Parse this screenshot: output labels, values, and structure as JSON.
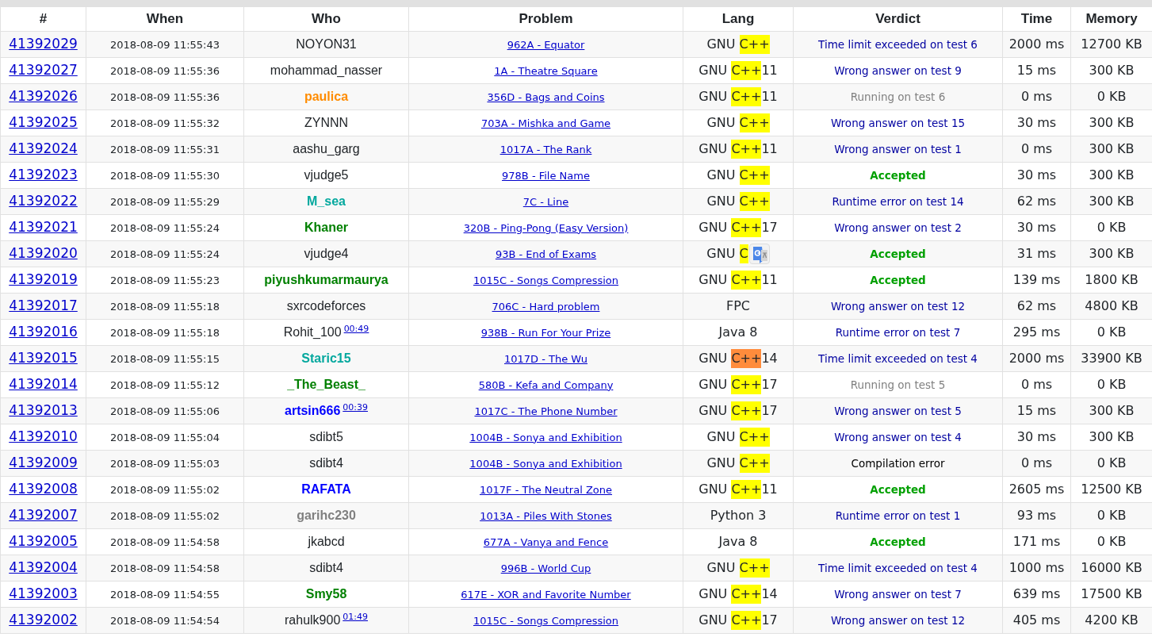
{
  "columns": [
    "#",
    "When",
    "Who",
    "Problem",
    "Lang",
    "Verdict",
    "Time",
    "Memory"
  ],
  "rows": [
    {
      "id": "41392029",
      "when": "2018-08-09 11:55:43",
      "who": {
        "name": "NOYON31"
      },
      "problem": "962A - Equator",
      "lang": {
        "prefix": "GNU ",
        "highlight": "C++",
        "color": "#ffff00"
      },
      "verdict": {
        "text": "Time limit exceeded on test 6",
        "kind": "rejected"
      },
      "time": "2000 ms",
      "memory": "12700 KB"
    },
    {
      "id": "41392027",
      "when": "2018-08-09 11:55:36",
      "who": {
        "name": "mohammad_nasser"
      },
      "problem": "1A - Theatre Square",
      "lang": {
        "prefix": "GNU ",
        "highlight": "C++",
        "suffix": "11",
        "color": "#ffff00"
      },
      "verdict": {
        "text": "Wrong answer on test 9",
        "kind": "rejected"
      },
      "time": "15 ms",
      "memory": "300 KB"
    },
    {
      "id": "41392026",
      "when": "2018-08-09 11:55:36",
      "who": {
        "name": "paulica",
        "color": "#ff8c00"
      },
      "problem": "356D - Bags and Coins",
      "lang": {
        "prefix": "GNU ",
        "highlight": "C++",
        "suffix": "11",
        "color": "#ffff00"
      },
      "verdict": {
        "text": "Running on test 6",
        "kind": "running"
      },
      "time": "0 ms",
      "memory": "0 KB"
    },
    {
      "id": "41392025",
      "when": "2018-08-09 11:55:32",
      "who": {
        "name": "ZYNNN"
      },
      "problem": "703A - Mishka and Game",
      "lang": {
        "prefix": "GNU ",
        "highlight": "C++",
        "color": "#ffff00"
      },
      "verdict": {
        "text": "Wrong answer on test 15",
        "kind": "rejected"
      },
      "time": "30 ms",
      "memory": "300 KB"
    },
    {
      "id": "41392024",
      "when": "2018-08-09 11:55:31",
      "who": {
        "name": "aashu_garg"
      },
      "problem": "1017A - The Rank",
      "lang": {
        "prefix": "GNU ",
        "highlight": "C++",
        "suffix": "11",
        "color": "#ffff00"
      },
      "verdict": {
        "text": "Wrong answer on test 1",
        "kind": "rejected"
      },
      "time": "0 ms",
      "memory": "300 KB"
    },
    {
      "id": "41392023",
      "when": "2018-08-09 11:55:30",
      "who": {
        "name": "vjudge5"
      },
      "problem": "978B - File Name",
      "lang": {
        "prefix": "GNU ",
        "highlight": "C++",
        "color": "#ffff00"
      },
      "verdict": {
        "text": "Accepted",
        "kind": "accepted"
      },
      "time": "30 ms",
      "memory": "300 KB"
    },
    {
      "id": "41392022",
      "when": "2018-08-09 11:55:29",
      "who": {
        "name": "M_sea",
        "color": "#03a89e"
      },
      "problem": "7C - Line",
      "lang": {
        "prefix": "GNU ",
        "highlight": "C++",
        "color": "#ffff00"
      },
      "verdict": {
        "text": "Runtime error on test 14",
        "kind": "rejected"
      },
      "time": "62 ms",
      "memory": "300 KB"
    },
    {
      "id": "41392021",
      "when": "2018-08-09 11:55:24",
      "who": {
        "name": "Khaner",
        "color": "#008000"
      },
      "problem": "320B - Ping-Pong (Easy Version)",
      "lang": {
        "prefix": "GNU ",
        "highlight": "C++",
        "suffix": "17",
        "color": "#ffff00"
      },
      "verdict": {
        "text": "Wrong answer on test 2",
        "kind": "rejected"
      },
      "time": "30 ms",
      "memory": "0 KB"
    },
    {
      "id": "41392020",
      "when": "2018-08-09 11:55:24",
      "who": {
        "name": "vjudge4"
      },
      "problem": "93B - End of Exams",
      "lang": {
        "prefix": "GNU ",
        "highlight": "C",
        "color": "#ffff00",
        "translate_popup": true
      },
      "verdict": {
        "text": "Accepted",
        "kind": "accepted"
      },
      "time": "31 ms",
      "memory": "300 KB"
    },
    {
      "id": "41392019",
      "when": "2018-08-09 11:55:23",
      "who": {
        "name": "piyushkumarmaurya",
        "color": "#008000"
      },
      "problem": "1015C - Songs Compression",
      "lang": {
        "prefix": "GNU ",
        "highlight": "C++",
        "suffix": "11",
        "color": "#ffff00"
      },
      "verdict": {
        "text": "Accepted",
        "kind": "accepted"
      },
      "time": "139 ms",
      "memory": "1800 KB"
    },
    {
      "id": "41392017",
      "when": "2018-08-09 11:55:18",
      "who": {
        "name": "sxrcodeforces"
      },
      "problem": "706C - Hard problem",
      "lang": {
        "prefix": "FPC"
      },
      "verdict": {
        "text": "Wrong answer on test 12",
        "kind": "rejected"
      },
      "time": "62 ms",
      "memory": "4800 KB"
    },
    {
      "id": "41392016",
      "when": "2018-08-09 11:55:18",
      "who": {
        "name": "Rohit_100",
        "virtual": "00:49"
      },
      "problem": "938B - Run For Your Prize",
      "lang": {
        "prefix": "Java 8"
      },
      "verdict": {
        "text": "Runtime error on test 7",
        "kind": "rejected"
      },
      "time": "295 ms",
      "memory": "0 KB"
    },
    {
      "id": "41392015",
      "when": "2018-08-09 11:55:15",
      "who": {
        "name": "Staric15",
        "color": "#03a89e"
      },
      "problem": "1017D - The Wu",
      "lang": {
        "prefix": "GNU ",
        "highlight": "C++",
        "suffix": "14",
        "color": "#ff8c3c"
      },
      "verdict": {
        "text": "Time limit exceeded on test 4",
        "kind": "rejected"
      },
      "time": "2000 ms",
      "memory": "33900 KB"
    },
    {
      "id": "41392014",
      "when": "2018-08-09 11:55:12",
      "who": {
        "name": "_The_Beast_",
        "color": "#008000"
      },
      "problem": "580B - Kefa and Company",
      "lang": {
        "prefix": "GNU ",
        "highlight": "C++",
        "suffix": "17",
        "color": "#ffff00"
      },
      "verdict": {
        "text": "Running on test 5",
        "kind": "running"
      },
      "time": "0 ms",
      "memory": "0 KB"
    },
    {
      "id": "41392013",
      "when": "2018-08-09 11:55:06",
      "who": {
        "name": "artsin666",
        "color": "#0000ff",
        "virtual": "00:39"
      },
      "problem": "1017C - The Phone Number",
      "lang": {
        "prefix": "GNU ",
        "highlight": "C++",
        "suffix": "17",
        "color": "#ffff00"
      },
      "verdict": {
        "text": "Wrong answer on test 5",
        "kind": "rejected"
      },
      "time": "15 ms",
      "memory": "300 KB"
    },
    {
      "id": "41392010",
      "when": "2018-08-09 11:55:04",
      "who": {
        "name": "sdibt5"
      },
      "problem": "1004B - Sonya and Exhibition",
      "lang": {
        "prefix": "GNU ",
        "highlight": "C++",
        "color": "#ffff00"
      },
      "verdict": {
        "text": "Wrong answer on test 4",
        "kind": "rejected"
      },
      "time": "30 ms",
      "memory": "300 KB"
    },
    {
      "id": "41392009",
      "when": "2018-08-09 11:55:03",
      "who": {
        "name": "sdibt4"
      },
      "problem": "1004B - Sonya and Exhibition",
      "lang": {
        "prefix": "GNU ",
        "highlight": "C++",
        "color": "#ffff00"
      },
      "verdict": {
        "text": "Compilation error",
        "kind": "compile"
      },
      "time": "0 ms",
      "memory": "0 KB"
    },
    {
      "id": "41392008",
      "when": "2018-08-09 11:55:02",
      "who": {
        "name": "RAFATA",
        "color": "#0000ff"
      },
      "problem": "1017F - The Neutral Zone",
      "lang": {
        "prefix": "GNU ",
        "highlight": "C++",
        "suffix": "11",
        "color": "#ffff00"
      },
      "verdict": {
        "text": "Accepted",
        "kind": "accepted"
      },
      "time": "2605 ms",
      "memory": "12500 KB"
    },
    {
      "id": "41392007",
      "when": "2018-08-09 11:55:02",
      "who": {
        "name": "garihc230",
        "color": "#808080"
      },
      "problem": "1013A - Piles With Stones",
      "lang": {
        "prefix": "Python 3"
      },
      "verdict": {
        "text": "Runtime error on test 1",
        "kind": "rejected"
      },
      "time": "93 ms",
      "memory": "0 KB"
    },
    {
      "id": "41392005",
      "when": "2018-08-09 11:54:58",
      "who": {
        "name": "jkabcd"
      },
      "problem": "677A - Vanya and Fence",
      "lang": {
        "prefix": "Java 8"
      },
      "verdict": {
        "text": "Accepted",
        "kind": "accepted"
      },
      "time": "171 ms",
      "memory": "0 KB"
    },
    {
      "id": "41392004",
      "when": "2018-08-09 11:54:58",
      "who": {
        "name": "sdibt4"
      },
      "problem": "996B - World Cup",
      "lang": {
        "prefix": "GNU ",
        "highlight": "C++",
        "color": "#ffff00"
      },
      "verdict": {
        "text": "Time limit exceeded on test 4",
        "kind": "rejected"
      },
      "time": "1000 ms",
      "memory": "16000 KB"
    },
    {
      "id": "41392003",
      "when": "2018-08-09 11:54:55",
      "who": {
        "name": "Smy58",
        "color": "#008000"
      },
      "problem": "617E - XOR and Favorite Number",
      "lang": {
        "prefix": "GNU ",
        "highlight": "C++",
        "suffix": "14",
        "color": "#ffff00"
      },
      "verdict": {
        "text": "Wrong answer on test 7",
        "kind": "rejected"
      },
      "time": "639 ms",
      "memory": "17500 KB"
    },
    {
      "id": "41392002",
      "when": "2018-08-09 11:54:54",
      "who": {
        "name": "rahulk900",
        "virtual": "01:49"
      },
      "problem": "1015C - Songs Compression",
      "lang": {
        "prefix": "GNU ",
        "highlight": "C++",
        "suffix": "17",
        "color": "#ffff00"
      },
      "verdict": {
        "text": "Wrong answer on test 12",
        "kind": "rejected"
      },
      "time": "405 ms",
      "memory": "4200 KB"
    }
  ]
}
